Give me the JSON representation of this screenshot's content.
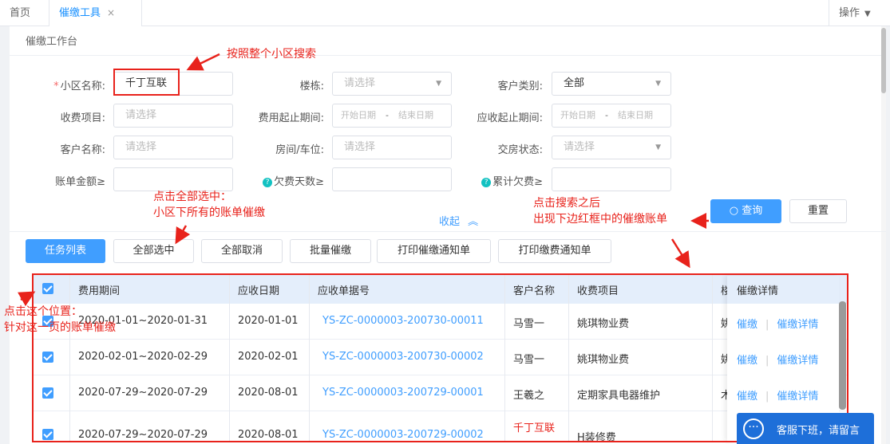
{
  "tabs": {
    "home": "首页",
    "active": "催缴工具",
    "close_glyph": "×",
    "ops": "操作"
  },
  "panel": {
    "title": "催缴工作台"
  },
  "form": {
    "community_label": "小区名称:",
    "community_value": "千丁互联",
    "building_label": "楼栋:",
    "building_placeholder": "请选择",
    "customer_type_label": "客户类别:",
    "customer_type_value": "全部",
    "fee_item_label": "收费项目:",
    "fee_item_placeholder": "请选择",
    "fee_period_label": "费用起止期间:",
    "start_date_placeholder": "开始日期",
    "range_sep": "-",
    "end_date_placeholder": "结束日期",
    "due_period_label": "应收起止期间:",
    "customer_name_label": "客户名称:",
    "customer_name_placeholder": "请选择",
    "room_label": "房间/车位:",
    "room_placeholder": "请选择",
    "delivery_label": "交房状态:",
    "delivery_placeholder": "请选择",
    "bill_amount_label": "账单金额≥",
    "overdue_days_label": "欠费天数≥",
    "total_owed_label": "累计欠费≥",
    "collapse_label": "收起",
    "query_label": "查询",
    "reset_label": "重置"
  },
  "toolbar": {
    "task_list": "任务列表",
    "select_all": "全部选中",
    "deselect_all": "全部取消",
    "batch_remind": "批量催缴",
    "print_remind": "打印催缴通知单",
    "print_payment": "打印缴费通知单"
  },
  "table": {
    "headers": {
      "period": "费用期间",
      "due_date": "应收日期",
      "bill_no": "应收单据号",
      "customer": "客户名称",
      "fee_item": "收费项目",
      "cut": "楼",
      "detail": "催缴详情"
    },
    "rows": [
      {
        "period": "2020-01-01~2020-01-31",
        "due_date": "2020-01-01",
        "bill_no": "YS-ZC-0000003-200730-00011",
        "customer": "马雪一",
        "fee_item": "姚琪物业费",
        "cut": "姚"
      },
      {
        "period": "2020-02-01~2020-02-29",
        "due_date": "2020-02-01",
        "bill_no": "YS-ZC-0000003-200730-00002",
        "customer": "马雪一",
        "fee_item": "姚琪物业费",
        "cut": "姚"
      },
      {
        "period": "2020-07-29~2020-07-29",
        "due_date": "2020-08-01",
        "bill_no": "YS-ZC-0000003-200729-00001",
        "customer": "王羲之",
        "fee_item": "定期家具电器维护",
        "cut": "木"
      },
      {
        "period": "2020-07-29~2020-07-29",
        "due_date": "2020-08-01",
        "bill_no": "YS-ZC-0000003-200729-00002",
        "customer": "千丁互联",
        "fee_item": "H装修费",
        "cut": ""
      }
    ],
    "action_remind": "催缴",
    "action_sep": "|",
    "action_detail": "催缴详情"
  },
  "annotations": {
    "search_community": "按照整个小区搜索",
    "select_all_1": "点击全部选中：",
    "select_all_2": "小区下所有的账单催缴",
    "after_search_1": "点击搜索之后",
    "after_search_2": "出现下边红框中的催缴账单",
    "this_page_1": "点击这个位置：",
    "this_page_2": "针对这一页的账单催缴"
  },
  "chat": {
    "label": "客服下班，请留言"
  },
  "colors": {
    "accent": "#409eff",
    "annotation": "#e8221b",
    "chat": "#1e6fd9"
  }
}
